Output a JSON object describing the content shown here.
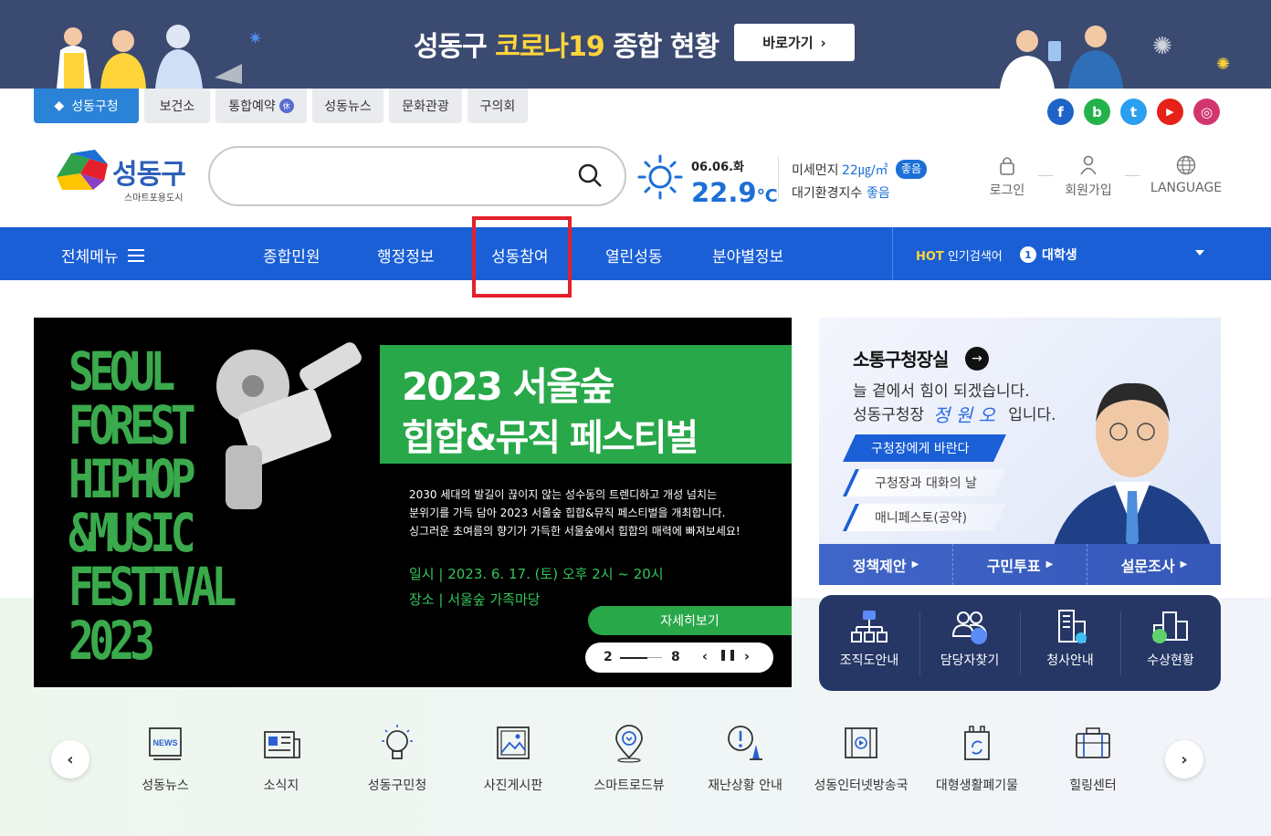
{
  "banner": {
    "title_pre": "성동구 ",
    "title_highlight": "코로나19",
    "title_post": " 종합 현황",
    "button_label": "바로가기"
  },
  "site_tabs": [
    "성동구청",
    "보건소",
    "통합예약",
    "성동뉴스",
    "문화관광",
    "구의회"
  ],
  "sns": [
    {
      "name": "facebook",
      "glyph": "f",
      "color": "#1e63c7"
    },
    {
      "name": "blog",
      "glyph": "b",
      "color": "#24b24a"
    },
    {
      "name": "twitter",
      "glyph": "t",
      "color": "#2b9ff0"
    },
    {
      "name": "youtube",
      "glyph": "▶",
      "color": "#e62117"
    },
    {
      "name": "instagram",
      "glyph": "◎",
      "color": "#d2366f"
    }
  ],
  "logo": {
    "text": "성동구",
    "sub": "스마트포용도시"
  },
  "search": {
    "placeholder": ""
  },
  "weather": {
    "date": "06.06.화",
    "temp": "22.9",
    "unit": "℃"
  },
  "air": {
    "dust_label": "미세먼지",
    "dust_value": "22㎍/㎥",
    "dust_status": "좋음",
    "index_label": "대기환경지수",
    "index_status": "좋음"
  },
  "util": {
    "login": "로그인",
    "join": "회원가입",
    "language": "LANGUAGE"
  },
  "gnb": {
    "all_menu": "전체메뉴",
    "items": [
      "종합민원",
      "행정정보",
      "성동참여",
      "열린성동",
      "분야별정보"
    ]
  },
  "hot": {
    "label_bold": "HOT",
    "label": " 인기검색어",
    "rank": "1",
    "keyword": "대학생"
  },
  "hero": {
    "poster_lines": [
      "SEOUL",
      "FOREST",
      "HIPHOP",
      "&MUSIC",
      "FESTIVAL",
      "2023"
    ],
    "title1": "2023 서울숲",
    "title2": "힙합&뮤직 페스티벌",
    "desc": [
      "2030 세대의 발길이 끊이지 않는 성수동의 트렌디하고 개성 넘치는",
      "분위기를 가득 담아 2023 서울숲 힙합&뮤직 페스티벌을 개최합니다.",
      "싱그러운 초여름의 향기가 가득한 서울숲에서 힙합의 매력에 빠져보세요!"
    ],
    "info_date": "일시  |  2023. 6. 17. (토) 오후 2시 ~ 20시",
    "info_place": "장소  |  서울숲 가족마당",
    "more": "자세히보기",
    "current": "2",
    "total": "8"
  },
  "mayor": {
    "title": "소통구청장실",
    "line1": "늘 곁에서 힘이 되겠습니다.",
    "line2_pre": "성동구청장",
    "signature": "정 원 오",
    "line2_post": "입니다.",
    "links": [
      "구청장에게 바란다",
      "구청장과 대화의 날",
      "매니페스토(공약)"
    ],
    "bar": [
      "정책제안",
      "구민투표",
      "설문조사"
    ]
  },
  "quick": [
    "조직도안내",
    "담당자찾기",
    "청사안내",
    "수상현황"
  ],
  "bottom_icons": [
    "성동뉴스",
    "소식지",
    "성동구민청",
    "사진게시판",
    "스마트로드뷰",
    "재난상황 안내",
    "성동인터넷방송국",
    "대형생활폐기물",
    "힐링센터"
  ],
  "colors": {
    "primary_blue": "#1a5fd6",
    "festival_green": "#29a84a",
    "banner_navy": "#3b4a71",
    "highlight_red": "#e5202a"
  }
}
